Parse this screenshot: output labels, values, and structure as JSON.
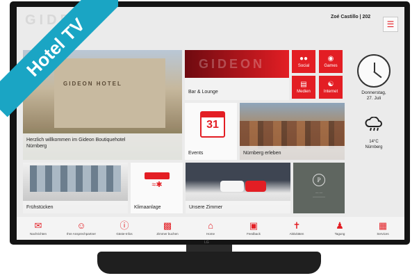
{
  "top": {
    "user": "Zoé Castillo | 202",
    "menu_icon": "hamburger-icon"
  },
  "ribbon": {
    "text": "Hotel TV"
  },
  "tiles": {
    "hotel": {
      "sign": "GIDEON HOTEL",
      "label_line1": "Herzlich willkommen im Gideon Boutiquehotel",
      "label_line2": "Nürnberg"
    },
    "bar": {
      "label": "Bar & Lounge"
    },
    "social": {
      "label": "Social",
      "icon": "people-icon"
    },
    "games": {
      "label": "Games",
      "icon": "gamepad-icon"
    },
    "medien": {
      "label": "Medien",
      "icon": "newspaper-icon"
    },
    "internet": {
      "label": "Internet",
      "icon": "globe-icon"
    },
    "events": {
      "label": "Events",
      "calendar_day": "31"
    },
    "nuernberg": {
      "label": "Nürnberg erleben"
    },
    "fruehstueck": {
      "label": "Frühstücken"
    },
    "klima": {
      "label": "Klimaanlage"
    },
    "zimmer": {
      "label": "Unsere Zimmer"
    },
    "brand": {
      "monogram": "P"
    }
  },
  "clock": {
    "date_line1": "Donnerstag,",
    "date_line2": "27. Juli",
    "time": "10:10"
  },
  "weather": {
    "temp": "14°C",
    "city": "Nürnberg",
    "icon": "rain-cloud-icon"
  },
  "nav": [
    {
      "label": "Nachrichten",
      "icon": "envelope-icon"
    },
    {
      "label": "Ihre Ansprechpartner",
      "icon": "contact-icon"
    },
    {
      "label": "Gäste-Infos",
      "icon": "info-icon"
    },
    {
      "label": "Zimmer buchen",
      "icon": "bed-icon"
    },
    {
      "label": "Home",
      "icon": "home-icon"
    },
    {
      "label": "Feedback",
      "icon": "feedback-icon"
    },
    {
      "label": "Aktivitäten",
      "icon": "signpost-icon"
    },
    {
      "label": "Tagung",
      "icon": "meeting-icon"
    },
    {
      "label": "Services",
      "icon": "grid-icon"
    }
  ],
  "colors": {
    "accent": "#e31e24",
    "ribbon": "#1aa5c4"
  }
}
